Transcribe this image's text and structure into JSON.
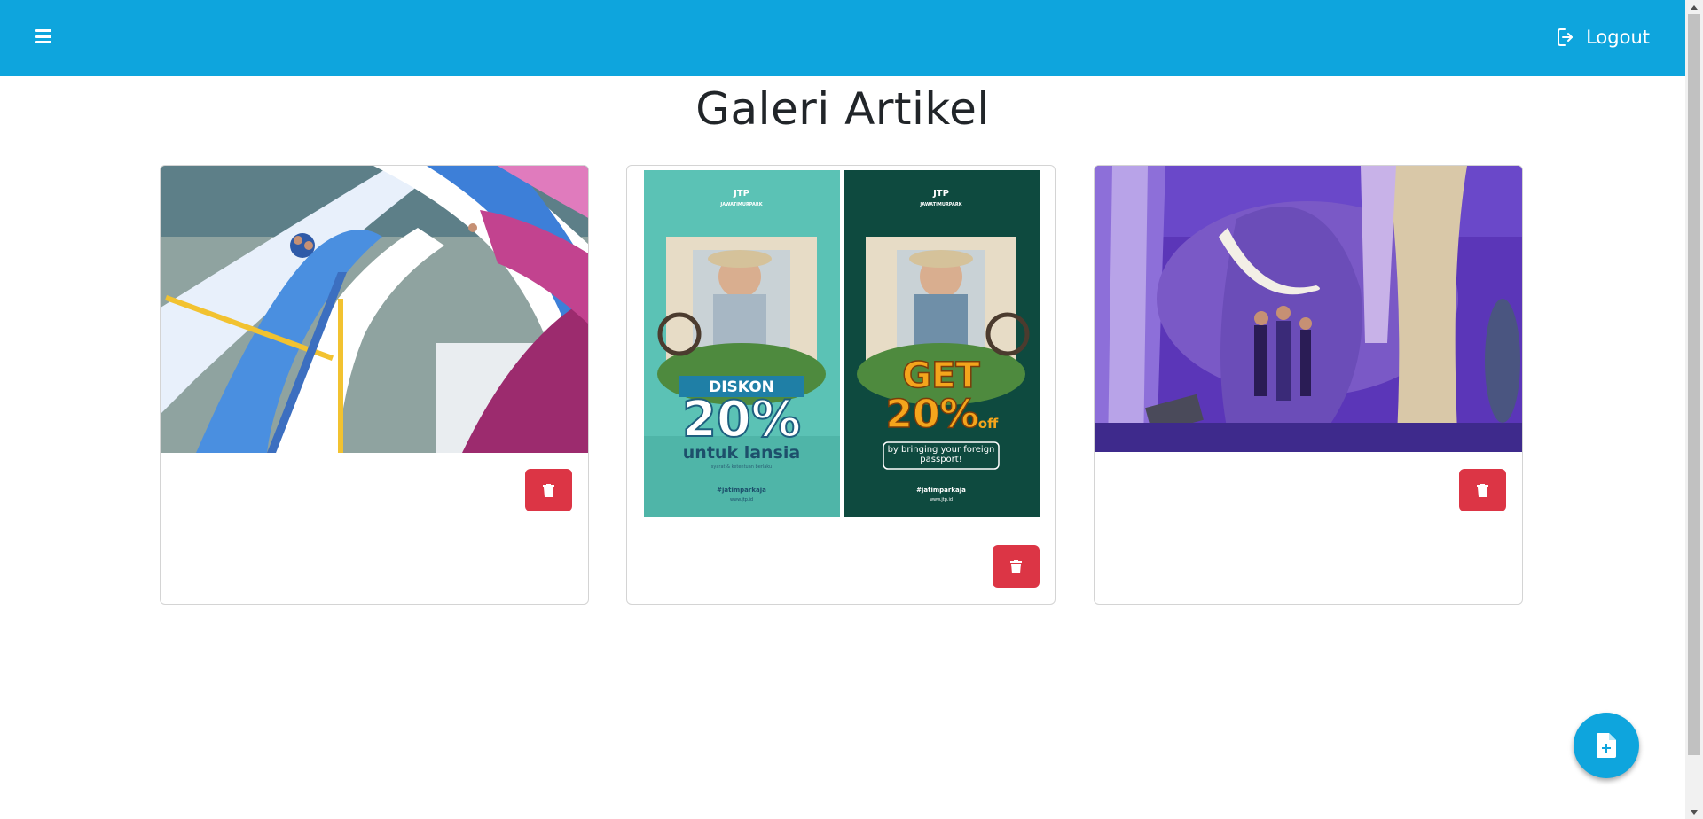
{
  "header": {
    "menu_icon": "hamburger-menu-icon",
    "logout_icon": "logout-icon",
    "logout_label": "Logout"
  },
  "page": {
    "title": "Galeri Artikel"
  },
  "cards": [
    {
      "image": "waterpark-slides-photo",
      "delete_icon": "trash-icon"
    },
    {
      "image": "promo-posters",
      "poster_left": {
        "brand": "JTP",
        "brand_sub": "JAWATIMURPARK",
        "headline": "DISKON",
        "percent": "20%",
        "subline": "untuk lansia",
        "fine": "syarat & ketentuan berlaku",
        "hashtag": "#jatimparkaja",
        "url": "www.jtp.id"
      },
      "poster_right": {
        "brand": "JTP",
        "brand_sub": "JAWATIMURPARK",
        "headline": "GET",
        "percent": "20%",
        "off": "off",
        "subline": "by bringing your foreign passport!",
        "hashtag": "#jatimparkaja",
        "url": "www.jtp.id"
      },
      "delete_icon": "trash-icon"
    },
    {
      "image": "museum-mammoth-photo",
      "delete_icon": "trash-icon"
    }
  ],
  "fab": {
    "icon": "add-document-icon"
  },
  "colors": {
    "accent": "#0ea5dd",
    "danger": "#dc3545",
    "text": "#212529"
  }
}
